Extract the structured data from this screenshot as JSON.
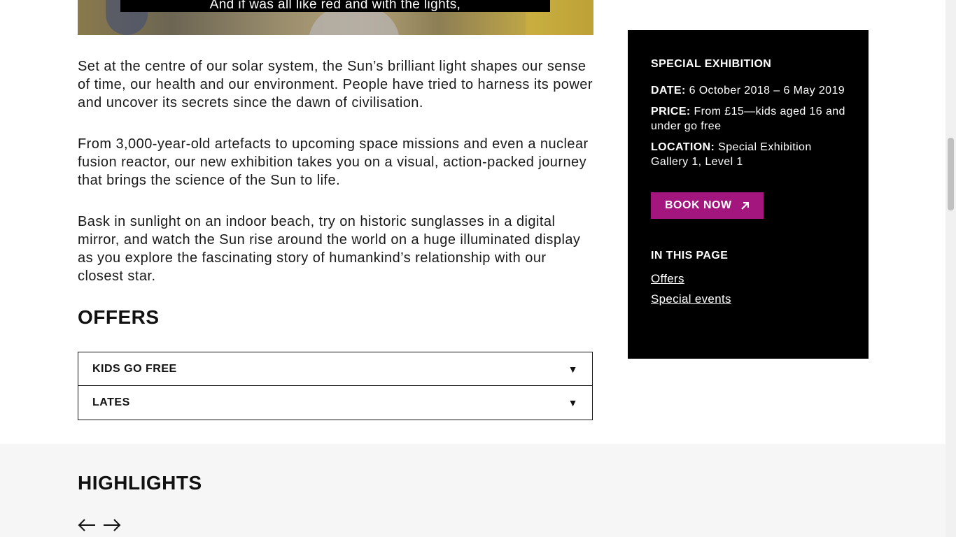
{
  "video": {
    "caption": "And if was all like red and with the lights,"
  },
  "main": {
    "paragraphs": [
      "Set at the centre of our solar system, the Sun’s brilliant light shapes our sense of time, our health and our environment. People have tried to harness its power and uncover its secrets since the dawn of civilisation.",
      "From 3,000-year-old artefacts to upcoming space missions and even a nuclear fusion reactor, our new exhibition takes you on a visual, action-packed journey that brings the science of the Sun to life.",
      "Bask in sunlight on an indoor beach, try on historic sunglasses in a digital mirror, and watch the Sun rise around the world on a huge illuminated display as you explore the fascinating story of humankind’s relationship with our closest star."
    ],
    "offers_heading": "OFFERS",
    "offers": [
      {
        "label": "KIDS GO FREE",
        "arrow": "▼"
      },
      {
        "label": "LATES",
        "arrow": "▼"
      }
    ]
  },
  "sidebar": {
    "heading": "SPECIAL EXHIBITION",
    "date_label": "DATE:",
    "date_value": "6 October 2018 – 6 May 2019",
    "price_label": "PRICE:",
    "price_value": "From £15—kids aged 16 and under go free",
    "location_label": "LOCATION:",
    "location_value": "Special Exhibition Gallery 1, Level 1",
    "book_label": "BOOK NOW",
    "book_color": "#a3167e",
    "in_page_heading": "IN THIS PAGE",
    "links": [
      "Offers",
      "Special events"
    ]
  },
  "highlights": {
    "heading": "HIGHLIGHTS",
    "prev_icon": "arrow-left-icon",
    "next_icon": "arrow-right-icon"
  }
}
